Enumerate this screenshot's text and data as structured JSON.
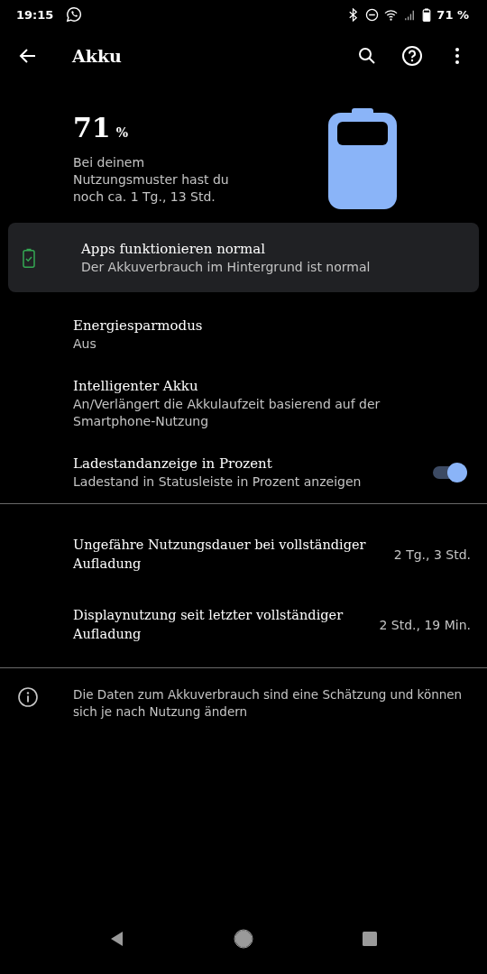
{
  "status_bar": {
    "time": "19:15",
    "battery_text": "71 %"
  },
  "toolbar": {
    "title": "Akku"
  },
  "summary": {
    "percent": "71",
    "unit": "%",
    "estimate": "Bei deinem Nutzungsmuster hast du noch ca. 1 Tg., 13 Std."
  },
  "status_card": {
    "title": "Apps funktionieren normal",
    "subtitle": "Der Akkuverbrauch im Hintergrund ist normal"
  },
  "settings": [
    {
      "kind": "plain",
      "title": "Energiesparmodus",
      "subtitle": "Aus"
    },
    {
      "kind": "plain",
      "title": "Intelligenter Akku",
      "subtitle": "An/Verlängert die Akkulaufzeit basierend auf der Smartphone-Nutzung"
    },
    {
      "kind": "toggle",
      "title": "Ladestandanzeige in Prozent",
      "subtitle": "Ladestand in Statusleiste in Prozent anzeigen",
      "on": true
    }
  ],
  "stats": [
    {
      "title": "Ungefähre Nutzungsdauer bei vollständiger Aufladung",
      "value": "2 Tg., 3 Std."
    },
    {
      "title": "Displaynutzung seit letzter vollständiger Aufladung",
      "value": "2 Std., 19 Min."
    }
  ],
  "footer_note": "Die Daten zum Akkuverbrauch sind eine Schätzung und können sich je nach Nutzung ändern"
}
